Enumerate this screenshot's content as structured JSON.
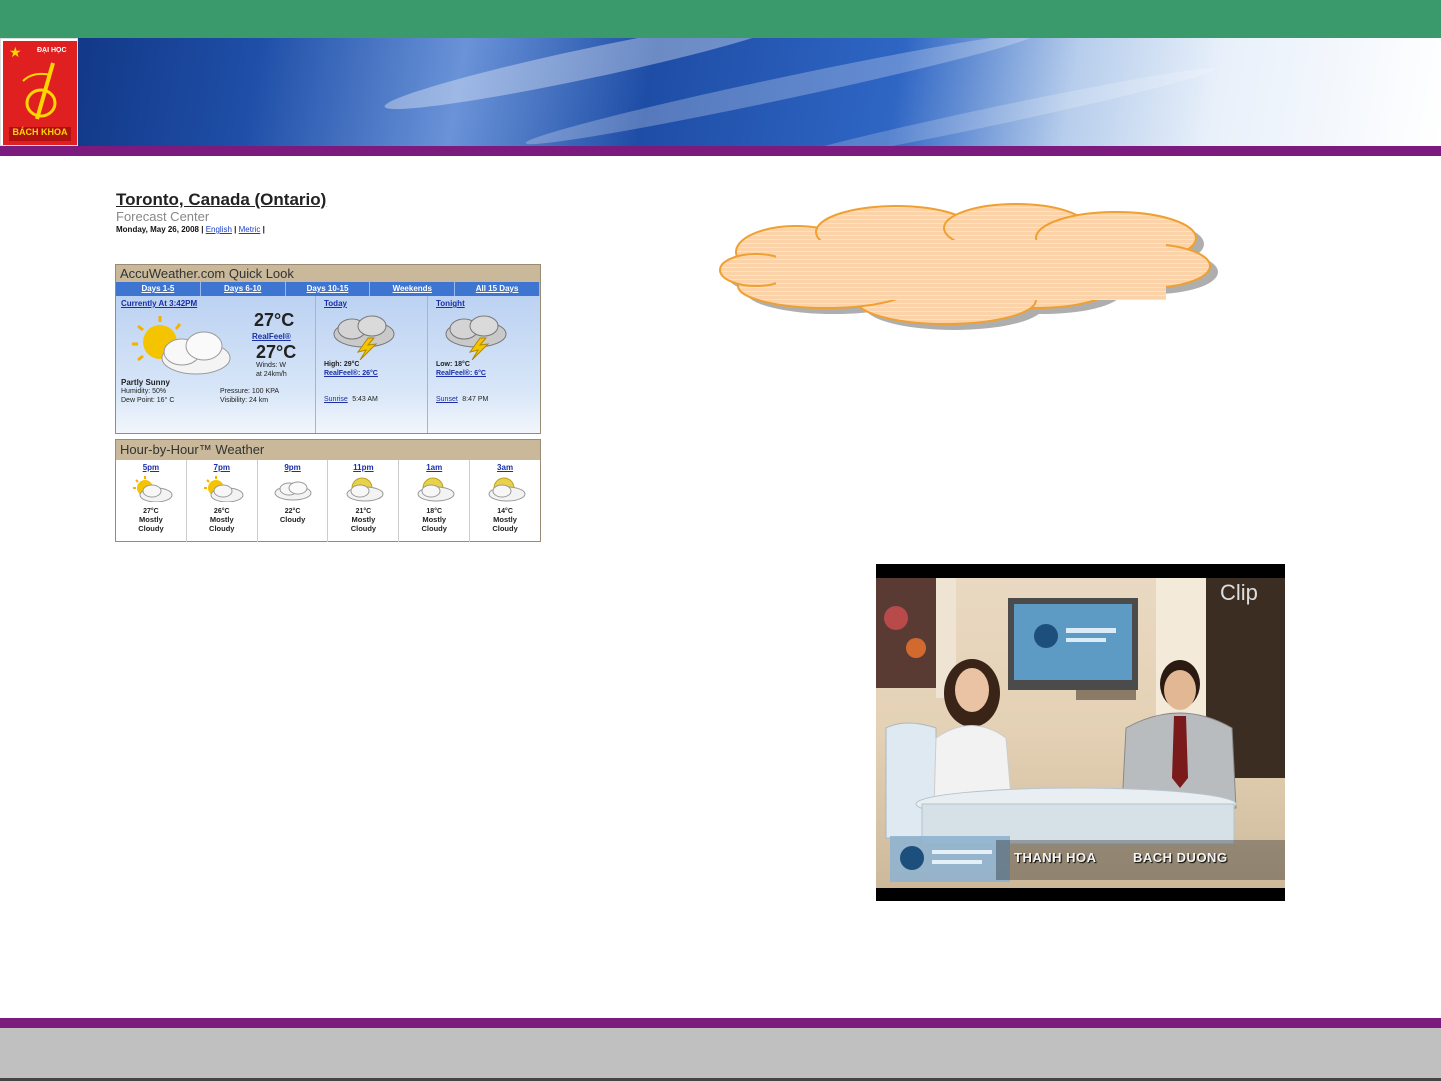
{
  "header": {
    "logo": {
      "top_text": "ĐẠI HỌC",
      "bottom_text": "BÁCH KHOA"
    },
    "colors": {
      "top_bar": "#3a9a6c",
      "accent_bar": "#7a1b7d",
      "footer": "#c0c0c0"
    }
  },
  "weather": {
    "title": "Toronto, Canada (Ontario)",
    "subtitle": "Forecast Center",
    "date": "Monday, May 26, 2008",
    "links": [
      "English",
      "Metric"
    ],
    "quick_look": {
      "heading": "AccuWeather.com Quick Look",
      "tabs": [
        "Days 1-5",
        "Days 6-10",
        "Days 10-15",
        "Weekends",
        "All 15 Days"
      ],
      "current": {
        "label": "Currently At 3:42PM",
        "temp": "27°C",
        "realfeel_label": "RealFeel®",
        "realfeel_temp": "27°C",
        "winds": "Winds: W",
        "wind_speed": "at 24km/h",
        "condition": "Partly Sunny",
        "humidity": "Humidity: 50%",
        "dew_point": "Dew Point: 16° C",
        "pressure": "Pressure: 100 KPA",
        "visibility": "Visibility: 24 km",
        "icon": "partly-sunny-icon"
      },
      "today": {
        "label": "Today",
        "high": "High: 29°C",
        "realfeel": "RealFeel®: 26°C",
        "sun_label": "Sunrise",
        "sun_time": "5:43 AM",
        "icon": "thunderstorm-icon"
      },
      "tonight": {
        "label": "Tonight",
        "low": "Low: 18°C",
        "realfeel": "RealFeel®: 6°C",
        "sun_label": "Sunset",
        "sun_time": "8:47 PM",
        "icon": "thunderstorm-icon"
      }
    },
    "hour_by_hour": {
      "heading": "Hour-by-Hour™ Weather",
      "hours": [
        {
          "time": "5pm",
          "temp": "27°C",
          "cond1": "Mostly",
          "cond2": "Cloudy",
          "icon": "partly-sunny-icon"
        },
        {
          "time": "7pm",
          "temp": "26°C",
          "cond1": "Mostly",
          "cond2": "Cloudy",
          "icon": "partly-sunny-icon"
        },
        {
          "time": "9pm",
          "temp": "22°C",
          "cond1": "Cloudy",
          "cond2": "",
          "icon": "cloud-icon"
        },
        {
          "time": "11pm",
          "temp": "21°C",
          "cond1": "Mostly",
          "cond2": "Cloudy",
          "icon": "night-cloud-icon"
        },
        {
          "time": "1am",
          "temp": "18°C",
          "cond1": "Mostly",
          "cond2": "Cloudy",
          "icon": "night-cloud-icon"
        },
        {
          "time": "3am",
          "temp": "14°C",
          "cond1": "Mostly",
          "cond2": "Cloudy",
          "icon": "night-cloud-icon"
        }
      ]
    }
  },
  "video": {
    "logo": "Clip",
    "presenter_left": "THANH HOA",
    "presenter_right": "BACH DUONG"
  }
}
